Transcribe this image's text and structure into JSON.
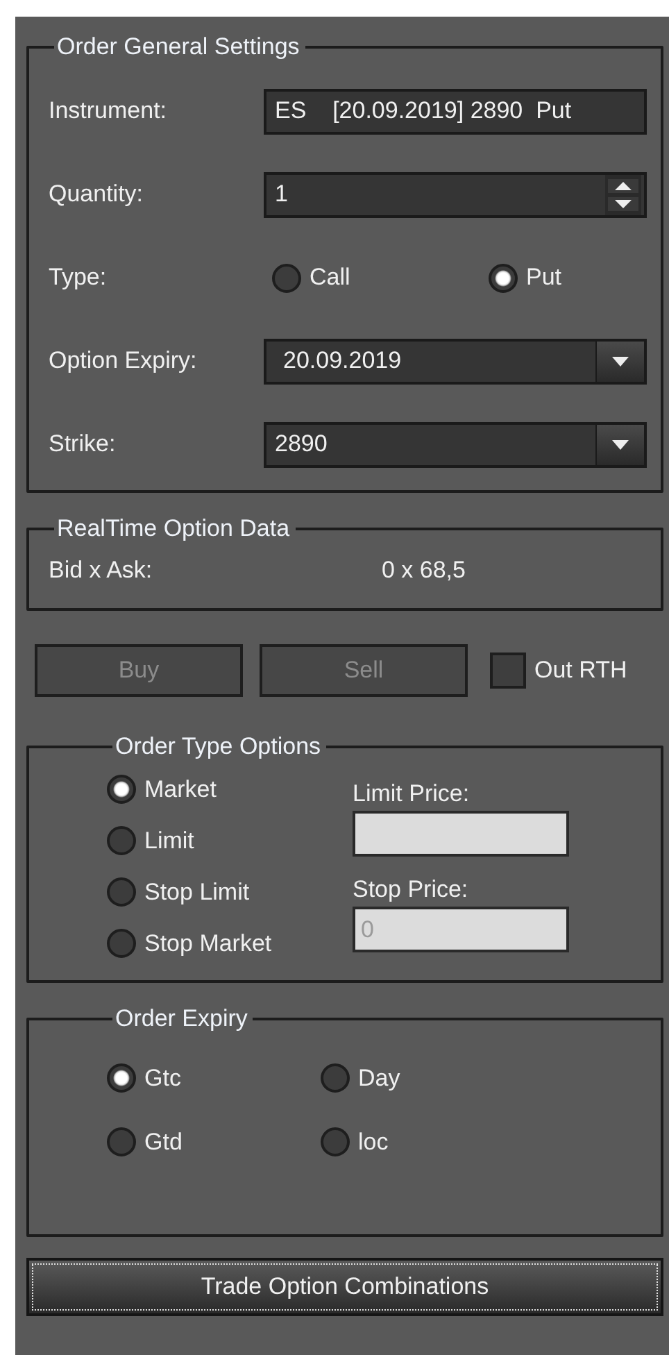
{
  "order_general_settings": {
    "title": "Order General Settings",
    "instrument": {
      "label": "Instrument:",
      "value": "ES    [20.09.2019] 2890  Put"
    },
    "quantity": {
      "label": "Quantity:",
      "value": "1"
    },
    "type": {
      "label": "Type:",
      "options": [
        {
          "label": "Call",
          "selected": false
        },
        {
          "label": "Put",
          "selected": true
        }
      ]
    },
    "option_expiry": {
      "label": "Option Expiry:",
      "value": "20.09.2019"
    },
    "strike": {
      "label": "Strike:",
      "value": "2890"
    }
  },
  "realtime_option_data": {
    "title": "RealTime Option Data",
    "label": "Bid x Ask:",
    "value": "0 x 68,5"
  },
  "actions": [
    {
      "label": "Buy",
      "disabled": true
    },
    {
      "label": "Sell",
      "disabled": true
    }
  ],
  "out_rth": {
    "label": "Out RTH",
    "checked": false
  },
  "order_type_options": {
    "title": "Order Type Options",
    "options": [
      {
        "label": "Market",
        "selected": true
      },
      {
        "label": "Limit",
        "selected": false
      },
      {
        "label": "Stop Limit",
        "selected": false
      },
      {
        "label": "Stop Market",
        "selected": false
      }
    ],
    "limit_price": {
      "label": "Limit Price:",
      "disabled": true
    },
    "stop_price": {
      "label": "Stop Price:",
      "value": "0",
      "disabled": true
    }
  },
  "order_expiry": {
    "title": "Order Expiry",
    "options": [
      {
        "label": "Gtc",
        "selected": true
      },
      {
        "label": "Day",
        "selected": false
      },
      {
        "label": "Gtd",
        "selected": false
      },
      {
        "label": "loc",
        "selected": false
      }
    ]
  },
  "trade_button": {
    "label": "Trade Option Combinations",
    "focused": true
  }
}
